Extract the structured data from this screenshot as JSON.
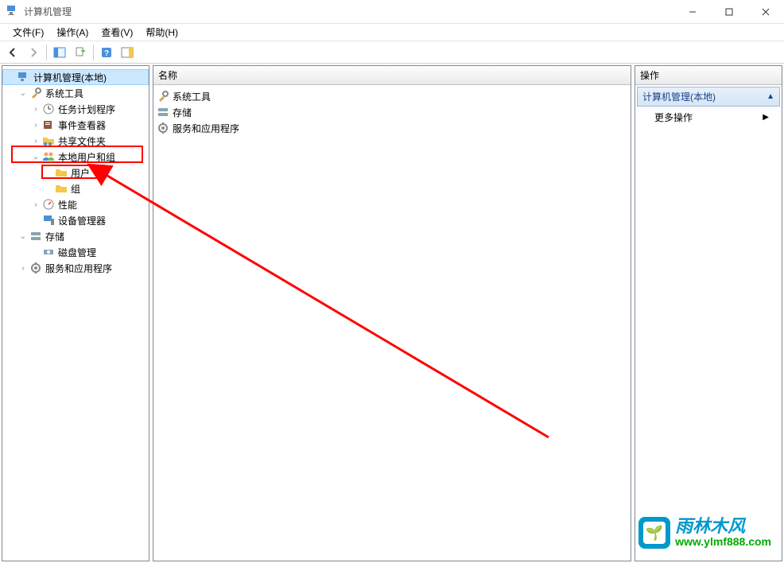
{
  "window": {
    "title": "计算机管理"
  },
  "menubar": {
    "file": "文件(F)",
    "action": "操作(A)",
    "view": "查看(V)",
    "help": "帮助(H)"
  },
  "tree": {
    "root": "计算机管理(本地)",
    "system_tools": "系统工具",
    "task_scheduler": "任务计划程序",
    "event_viewer": "事件查看器",
    "shared_folders": "共享文件夹",
    "local_users_groups": "本地用户和组",
    "users": "用户",
    "groups": "组",
    "performance": "性能",
    "device_manager": "设备管理器",
    "storage": "存储",
    "disk_management": "磁盘管理",
    "services_apps": "服务和应用程序"
  },
  "content": {
    "header": "名称",
    "items": [
      "系统工具",
      "存储",
      "服务和应用程序"
    ]
  },
  "actions": {
    "header": "操作",
    "section_title": "计算机管理(本地)",
    "more_actions": "更多操作"
  },
  "watermark": {
    "main": "雨林木风",
    "sub": "www.ylmf888.com"
  }
}
